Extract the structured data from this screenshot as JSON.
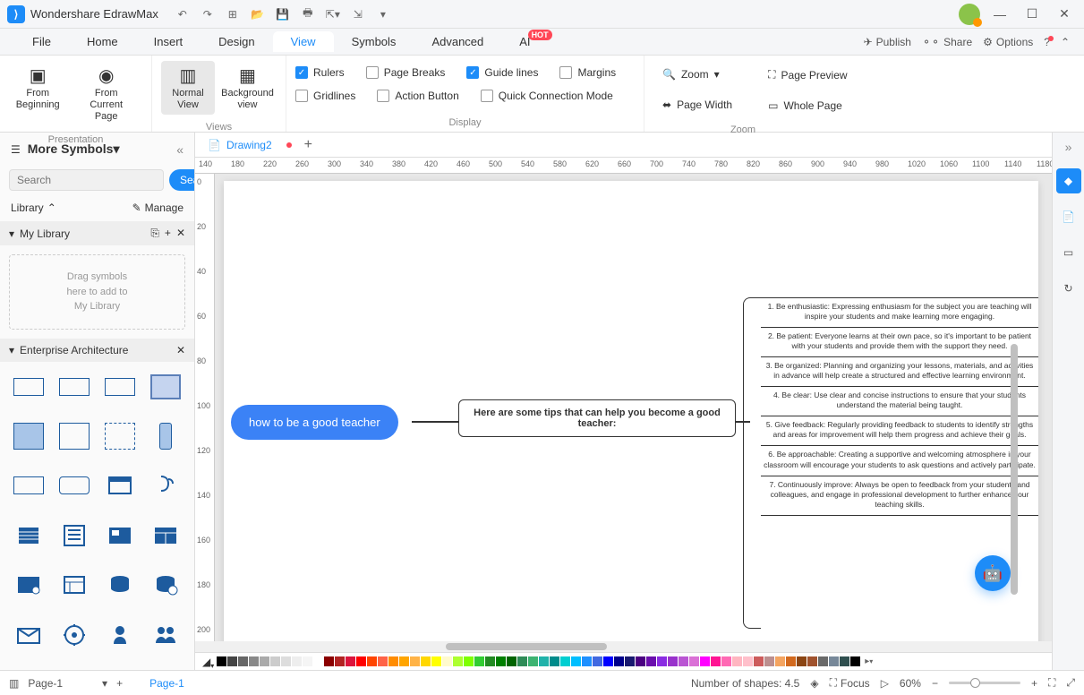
{
  "app": {
    "title": "Wondershare EdrawMax"
  },
  "menu": {
    "items": [
      "File",
      "Home",
      "Insert",
      "Design",
      "View",
      "Symbols",
      "Advanced",
      "AI"
    ],
    "active": "View",
    "hot": "HOT",
    "publish": "Publish",
    "share": "Share",
    "options": "Options"
  },
  "ribbon": {
    "presentation": {
      "label": "Presentation",
      "from_beginning": "From\nBeginning",
      "from_current": "From Current\nPage"
    },
    "views": {
      "label": "Views",
      "normal": "Normal\nView",
      "background": "Background\nview"
    },
    "display": {
      "label": "Display",
      "rulers": "Rulers",
      "pagebreaks": "Page Breaks",
      "guidelines": "Guide lines",
      "margins": "Margins",
      "gridlines": "Gridlines",
      "actionbutton": "Action Button",
      "quickconn": "Quick Connection Mode"
    },
    "zoom": {
      "label": "Zoom",
      "zoom": "Zoom",
      "pagewidth": "Page Width",
      "pagepreview": "Page Preview",
      "wholepage": "Whole Page"
    }
  },
  "sidebar": {
    "title": "More Symbols",
    "search_placeholder": "Search",
    "search_btn": "Search",
    "library": "Library",
    "manage": "Manage",
    "mylibrary": "My Library",
    "dropzone": "Drag symbols\nhere to add to\nMy Library",
    "enterprise": "Enterprise Architecture"
  },
  "doc": {
    "tab": "Drawing2",
    "main_node": "how to be a good teacher",
    "sub_node": "Here are some tips that can help you become a good teacher:",
    "tips": [
      "1. Be enthusiastic: Expressing enthusiasm for the subject you are teaching will inspire your students and make learning more engaging.",
      "2. Be patient: Everyone learns at their own pace, so it's important to be patient with your students and provide them with the support they need.",
      "3. Be organized: Planning and organizing your lessons, materials, and activities in advance will help create a structured and effective learning environment.",
      "4. Be clear: Use clear and concise instructions to ensure that your students understand the material being taught.",
      "5. Give feedback: Regularly providing feedback to students to identify strengths and areas for improvement will help them progress and achieve their goals.",
      "6. Be approachable: Creating a supportive and welcoming atmosphere in your classroom will encourage your students to ask questions and actively participate.",
      "7. Continuously improve: Always be open to feedback from your students and colleagues, and engage in professional development to further enhance your teaching skills."
    ]
  },
  "status": {
    "page_sel": "Page-1",
    "page_tab": "Page-1",
    "shapes": "Number of shapes: 4.5",
    "focus": "Focus",
    "zoom": "60%"
  },
  "ruler_h": [
    "140",
    "180",
    "220",
    "260",
    "300",
    "340",
    "380",
    "420",
    "460",
    "500",
    "540",
    "580",
    "620",
    "660",
    "700",
    "740",
    "780",
    "820",
    "860",
    "900",
    "940",
    "980",
    "1020",
    "1060",
    "1100",
    "1140",
    "1180"
  ],
  "ruler_v": [
    "0",
    "20",
    "40",
    "60",
    "80",
    "100",
    "120",
    "140",
    "160",
    "180",
    "200"
  ],
  "colors": [
    "#000",
    "#444",
    "#666",
    "#888",
    "#aaa",
    "#ccc",
    "#ddd",
    "#eee",
    "#f5f5f5",
    "#fff",
    "#8b0000",
    "#b22222",
    "#dc143c",
    "#ff0000",
    "#ff4500",
    "#ff6347",
    "#ff8c00",
    "#ffa500",
    "#ffb347",
    "#ffd700",
    "#ffff00",
    "#fffacd",
    "#adff2f",
    "#7fff00",
    "#32cd32",
    "#228b22",
    "#008000",
    "#006400",
    "#2e8b57",
    "#3cb371",
    "#20b2aa",
    "#008b8b",
    "#00ced1",
    "#00bfff",
    "#1e90ff",
    "#4169e1",
    "#0000ff",
    "#00008b",
    "#191970",
    "#4b0082",
    "#6a0dad",
    "#8a2be2",
    "#9932cc",
    "#ba55d3",
    "#da70d6",
    "#ff00ff",
    "#ff1493",
    "#ff69b4",
    "#ffb6c1",
    "#ffc0cb",
    "#cd5c5c",
    "#bc8f8f",
    "#f4a460",
    "#d2691e",
    "#8b4513",
    "#a0522d",
    "#696969",
    "#778899",
    "#2f4f4f",
    "#000"
  ]
}
